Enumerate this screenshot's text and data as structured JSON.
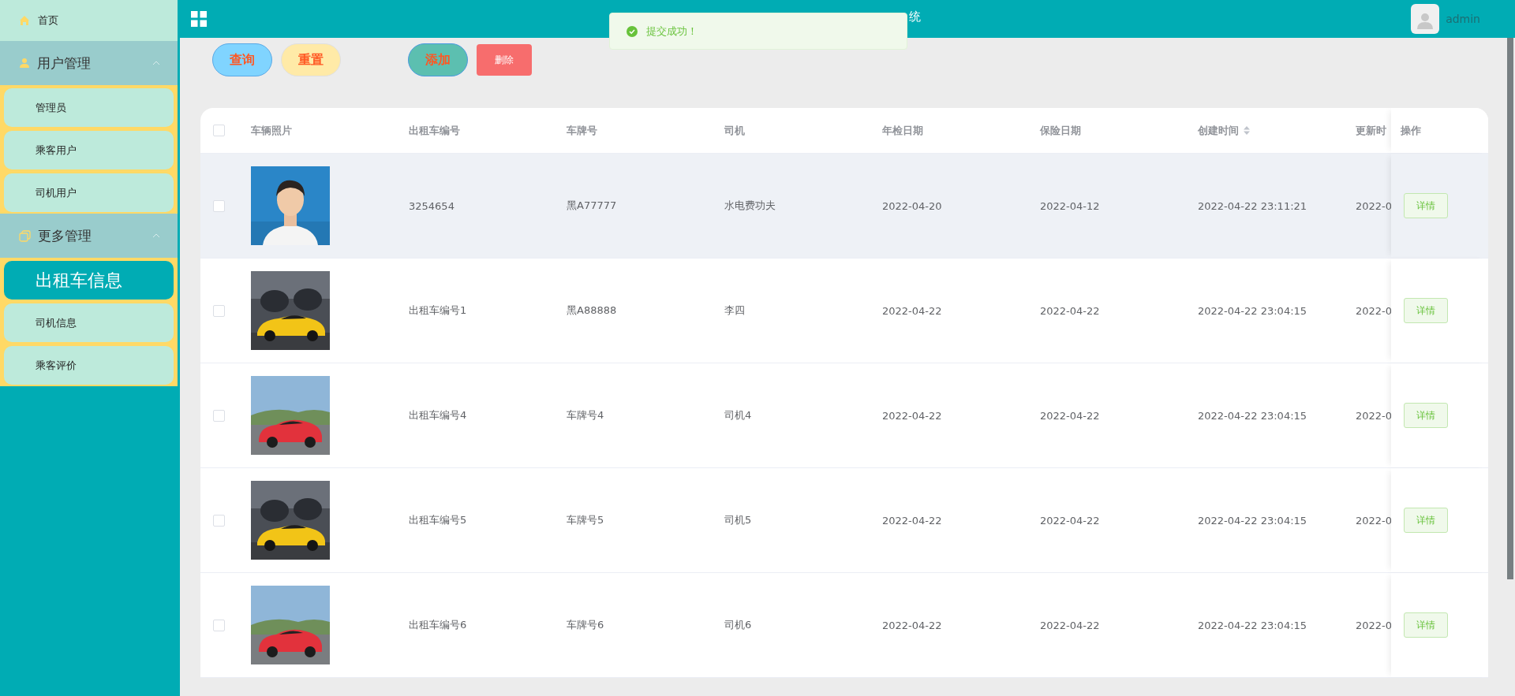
{
  "header": {
    "title": "统",
    "username": "admin"
  },
  "toast": {
    "message": "提交成功！"
  },
  "sidebar": {
    "items": [
      {
        "kind": "link",
        "label": "首页",
        "selected": false
      },
      {
        "kind": "group",
        "label": "用户管理",
        "expanded": true,
        "children": [
          {
            "label": "管理员",
            "selected": false
          },
          {
            "label": "乘客用户",
            "selected": false
          },
          {
            "label": "司机用户",
            "selected": false
          }
        ]
      },
      {
        "kind": "group",
        "label": "更多管理",
        "expanded": true,
        "children": [
          {
            "label": "出租车信息",
            "selected": true
          },
          {
            "label": "司机信息",
            "selected": false
          },
          {
            "label": "乘客评价",
            "selected": false
          }
        ]
      }
    ]
  },
  "toolbar": {
    "buttons": [
      {
        "kind": "search",
        "label": "查询"
      },
      {
        "kind": "reset",
        "label": "重置"
      },
      {
        "kind": "add",
        "label": "添加"
      },
      {
        "kind": "delete",
        "label": "删除"
      }
    ]
  },
  "table": {
    "all_checked": false,
    "columns": [
      {
        "label": "车辆照片",
        "sortable": false
      },
      {
        "label": "出租车编号",
        "sortable": false
      },
      {
        "label": "车牌号",
        "sortable": false
      },
      {
        "label": "司机",
        "sortable": false
      },
      {
        "label": "年检日期",
        "sortable": false
      },
      {
        "label": "保险日期",
        "sortable": false
      },
      {
        "label": "创建时间",
        "sortable": true
      },
      {
        "label": "更新时",
        "sortable": false
      },
      {
        "label": "操作",
        "sortable": false
      }
    ],
    "rows": [
      {
        "checked": false,
        "selected": true,
        "cells": [
          {
            "kind": "picture"
          },
          {
            "kind": "text",
            "text": "3254654"
          },
          {
            "kind": "text",
            "text": "黑A77777"
          },
          {
            "kind": "text",
            "text": "水电费功夫"
          },
          {
            "kind": "text",
            "text": "2022-04-20"
          },
          {
            "kind": "text",
            "text": "2022-04-12"
          },
          {
            "kind": "text",
            "text": "2022-04-22 23:11:21"
          },
          {
            "kind": "text",
            "text": "2022-0"
          },
          {
            "kind": "button",
            "text": "详情"
          }
        ]
      },
      {
        "checked": false,
        "selected": false,
        "cells": [
          {
            "kind": "picture"
          },
          {
            "kind": "text",
            "text": "出租车编号1"
          },
          {
            "kind": "text",
            "text": "黑A88888"
          },
          {
            "kind": "text",
            "text": "李四"
          },
          {
            "kind": "text",
            "text": "2022-04-22"
          },
          {
            "kind": "text",
            "text": "2022-04-22"
          },
          {
            "kind": "text",
            "text": "2022-04-22 23:04:15"
          },
          {
            "kind": "text",
            "text": "2022-0"
          },
          {
            "kind": "button",
            "text": "详情"
          }
        ]
      },
      {
        "checked": false,
        "selected": false,
        "cells": [
          {
            "kind": "picture"
          },
          {
            "kind": "text",
            "text": "出租车编号4"
          },
          {
            "kind": "text",
            "text": "车牌号4"
          },
          {
            "kind": "text",
            "text": "司机4"
          },
          {
            "kind": "text",
            "text": "2022-04-22"
          },
          {
            "kind": "text",
            "text": "2022-04-22"
          },
          {
            "kind": "text",
            "text": "2022-04-22 23:04:15"
          },
          {
            "kind": "text",
            "text": "2022-0"
          },
          {
            "kind": "button",
            "text": "详情"
          }
        ]
      },
      {
        "checked": false,
        "selected": false,
        "cells": [
          {
            "kind": "picture"
          },
          {
            "kind": "text",
            "text": "出租车编号5"
          },
          {
            "kind": "text",
            "text": "车牌号5"
          },
          {
            "kind": "text",
            "text": "司机5"
          },
          {
            "kind": "text",
            "text": "2022-04-22"
          },
          {
            "kind": "text",
            "text": "2022-04-22"
          },
          {
            "kind": "text",
            "text": "2022-04-22 23:04:15"
          },
          {
            "kind": "text",
            "text": "2022-0"
          },
          {
            "kind": "button",
            "text": "详情"
          }
        ]
      },
      {
        "checked": false,
        "selected": false,
        "cells": [
          {
            "kind": "picture"
          },
          {
            "kind": "text",
            "text": "出租车编号6"
          },
          {
            "kind": "text",
            "text": "车牌号6"
          },
          {
            "kind": "text",
            "text": "司机6"
          },
          {
            "kind": "text",
            "text": "2022-04-22"
          },
          {
            "kind": "text",
            "text": "2022-04-22"
          },
          {
            "kind": "text",
            "text": "2022-04-22 23:04:15"
          },
          {
            "kind": "text",
            "text": "2022-0"
          },
          {
            "kind": "button",
            "text": "详情"
          }
        ]
      }
    ]
  }
}
